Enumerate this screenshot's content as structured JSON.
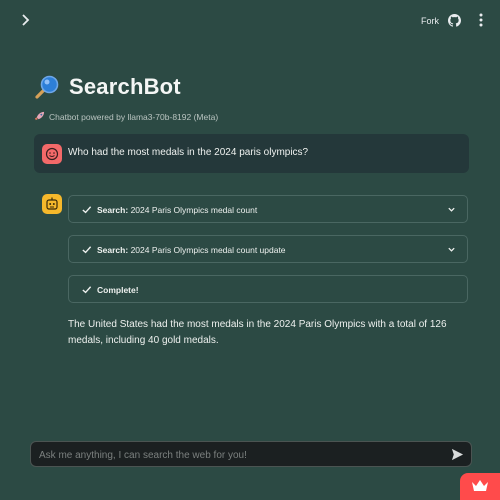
{
  "header": {
    "fork_label": "Fork",
    "icons": [
      "chevron-right-icon",
      "github-icon",
      "more-vertical-icon"
    ]
  },
  "app": {
    "title": "SearchBot",
    "title_icon": "magnifier-icon",
    "caption": "Chatbot powered by llama3-70b-8192 (Meta)",
    "caption_icon": "rocket-icon"
  },
  "chat": {
    "user_message": "Who had the most medals in the 2024 paris olympics?",
    "steps": [
      {
        "prefix": "Search:",
        "text": "2024 Paris Olympics medal count",
        "expandable": true
      },
      {
        "prefix": "Search:",
        "text": "2024 Paris Olympics medal count update",
        "expandable": true
      },
      {
        "prefix": "Complete!",
        "text": "",
        "expandable": false
      }
    ],
    "answer": "The United States had the most medals in the 2024 Paris Olympics with a total of 126 medals, including 40 gold medals."
  },
  "input": {
    "placeholder": "Ask me anything, I can search the web for you!",
    "value": ""
  },
  "colors": {
    "background": "#2c4a44",
    "user_avatar": "#f36969",
    "bot_avatar": "#f6b82b",
    "accent": "#ff4b4b"
  }
}
